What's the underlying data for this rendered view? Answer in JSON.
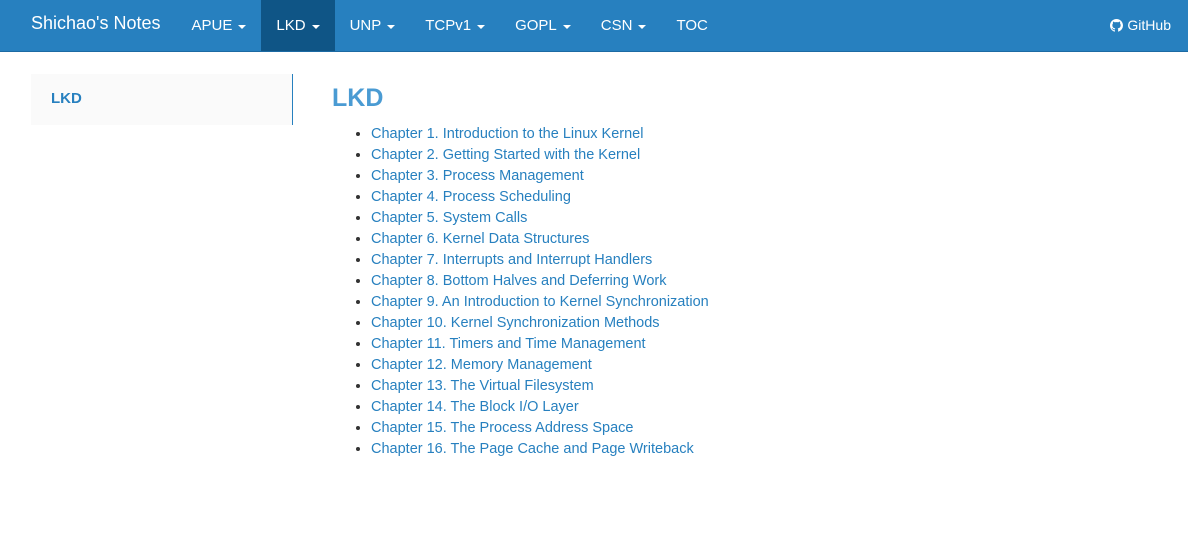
{
  "navbar": {
    "brand": "Shichao's Notes",
    "items": [
      {
        "label": "APUE",
        "dropdown": true,
        "active": false
      },
      {
        "label": "LKD",
        "dropdown": true,
        "active": true
      },
      {
        "label": "UNP",
        "dropdown": true,
        "active": false
      },
      {
        "label": "TCPv1",
        "dropdown": true,
        "active": false
      },
      {
        "label": "GOPL",
        "dropdown": true,
        "active": false
      },
      {
        "label": "CSN",
        "dropdown": true,
        "active": false
      },
      {
        "label": "TOC",
        "dropdown": false,
        "active": false
      }
    ],
    "github_label": "GitHub",
    "github_icon": "github-icon"
  },
  "sidebar": {
    "items": [
      {
        "label": "LKD"
      }
    ]
  },
  "main": {
    "title": "LKD",
    "chapters": [
      "Chapter 1. Introduction to the Linux Kernel",
      "Chapter 2. Getting Started with the Kernel",
      "Chapter 3. Process Management",
      "Chapter 4. Process Scheduling",
      "Chapter 5. System Calls",
      "Chapter 6. Kernel Data Structures",
      "Chapter 7. Interrupts and Interrupt Handlers",
      "Chapter 8. Bottom Halves and Deferring Work",
      "Chapter 9. An Introduction to Kernel Synchronization",
      "Chapter 10. Kernel Synchronization Methods",
      "Chapter 11. Timers and Time Management",
      "Chapter 12. Memory Management",
      "Chapter 13. The Virtual Filesystem",
      "Chapter 14. The Block I/O Layer",
      "Chapter 15. The Process Address Space",
      "Chapter 16. The Page Cache and Page Writeback"
    ]
  },
  "colors": {
    "navbar_bg": "#2780bf",
    "navbar_active": "#0f5586",
    "link": "#2780bf",
    "heading": "#4a9bd3"
  }
}
